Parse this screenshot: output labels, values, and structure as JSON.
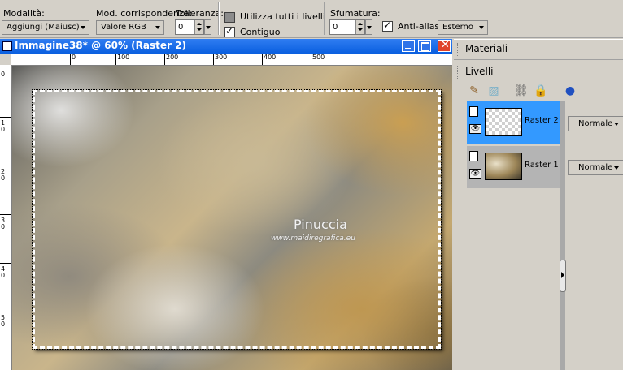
{
  "toolbar": {
    "mode": {
      "label": "Modalità:",
      "value": "Aggiungi (Maiusc)"
    },
    "match": {
      "label": "Mod. corrispondenza:",
      "value": "Valore RGB"
    },
    "tolerance": {
      "label": "Tolleranza:",
      "value": "0"
    },
    "use_all_layers": {
      "label": "Utilizza tutti i livelli",
      "checked": false
    },
    "contiguous": {
      "label": "Contiguo",
      "checked": true
    },
    "feather": {
      "label": "Sfumatura:",
      "value": "0"
    },
    "antialias": {
      "label": "Anti-alias",
      "checked": true,
      "value": "Esterno"
    }
  },
  "image_window": {
    "title": "Immagine38* @  60% (Raster 2)",
    "ruler_top": [
      "0",
      "100",
      "200",
      "300",
      "400",
      "500"
    ],
    "ruler_left": [
      "0",
      "1",
      "0",
      "2",
      "0",
      "3",
      "0",
      "4",
      "0",
      "5",
      "0"
    ],
    "watermark_title": "Pinuccia",
    "watermark_url": "www.maidiregrafica.eu"
  },
  "panels": {
    "materials_title": "Materiali",
    "layers_title": "Livelli",
    "layers": [
      {
        "name": "Raster 2",
        "blend": "Normale",
        "selected": true
      },
      {
        "name": "Raster 1",
        "blend": "Normale",
        "selected": false
      }
    ]
  },
  "colors": {
    "title_bar": "#0a5fe0",
    "selected_layer": "#3399ff",
    "close_button": "#e0442a"
  }
}
